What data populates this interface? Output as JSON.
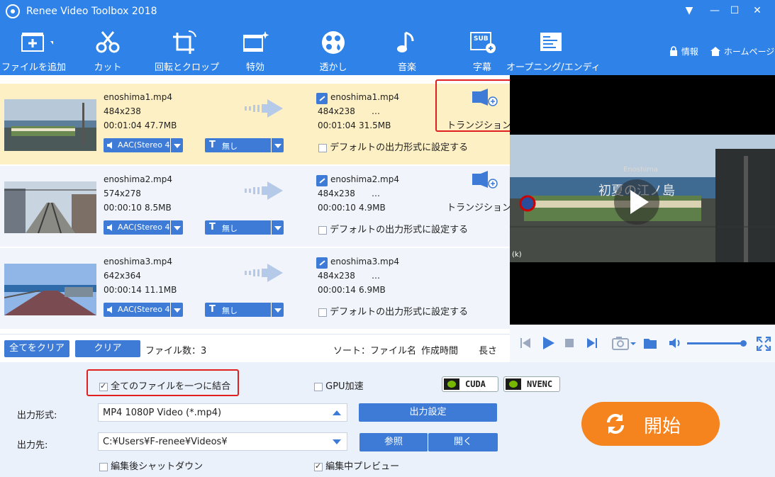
{
  "app": {
    "title": "Renee Video Toolbox 2018"
  },
  "window_controls": {
    "menu": "▼",
    "minimize": "—",
    "maximize": "☐",
    "close": "✕"
  },
  "toolbar": {
    "items": [
      {
        "label": "ファイルを追加",
        "icon": "add-file-icon"
      },
      {
        "label": "カット",
        "icon": "scissors-icon"
      },
      {
        "label": "回転とクロップ",
        "icon": "crop-rotate-icon"
      },
      {
        "label": "特効",
        "icon": "effects-icon"
      },
      {
        "label": "透かし",
        "icon": "watermark-icon"
      },
      {
        "label": "音楽",
        "icon": "music-note-icon"
      },
      {
        "label": "字幕",
        "icon": "subtitle-icon"
      },
      {
        "label": "オープニング/エンディ",
        "icon": "opening-ending-icon"
      }
    ],
    "info": "情報",
    "home": "ホームページ"
  },
  "files": [
    {
      "source": {
        "name": "enoshima1.mp4",
        "resolution": "484x238",
        "duration": "00:01:04",
        "size": "47.7MB"
      },
      "output": {
        "name": "enoshima1.mp4",
        "resolution": "484x238",
        "more": "…",
        "duration": "00:01:04",
        "size": "31.5MB"
      },
      "audio": "AAC(Stereo 4",
      "subtitle": "無し",
      "transition": "トランジション無",
      "default_format": "デフォルトの出力形式に設定する",
      "selected": true
    },
    {
      "source": {
        "name": "enoshima2.mp4",
        "resolution": "574x278",
        "duration": "00:00:10",
        "size": "8.5MB"
      },
      "output": {
        "name": "enoshima2.mp4",
        "resolution": "484x238",
        "more": "…",
        "duration": "00:00:10",
        "size": "4.9MB"
      },
      "audio": "AAC(Stereo 4",
      "subtitle": "無し",
      "transition": "トランジション無",
      "default_format": "デフォルトの出力形式に設定する",
      "selected": false
    },
    {
      "source": {
        "name": "enoshima3.mp4",
        "resolution": "642x364",
        "duration": "00:00:14",
        "size": "11.1MB"
      },
      "output": {
        "name": "enoshima3.mp4",
        "resolution": "484x238",
        "more": "…",
        "duration": "00:00:14",
        "size": "6.9MB"
      },
      "audio": "AAC(Stereo 4",
      "subtitle": "無し",
      "transition": "",
      "default_format": "デフォルトの出力形式に設定する",
      "selected": false
    }
  ],
  "list_footer": {
    "clear_all": "全てをクリア",
    "clear": "クリア",
    "file_count": "ファイル数：3",
    "sort_label": "ソート：ファイル名",
    "sort_created": "作成時間",
    "sort_length": "長さ"
  },
  "preview": {
    "overlay_text": "初夏の江ノ島",
    "overlay_small": "Enoshima",
    "corner_label": "(k)"
  },
  "player": {
    "volume_fraction": 0.98
  },
  "bottom": {
    "merge_label": "全てのファイルを一つに結合",
    "merge_checked": true,
    "gpu_label": "GPU加速",
    "gpu_checked": false,
    "cuda": "CUDA",
    "nvenc": "NVENC",
    "format_label": "出力形式:",
    "format_value": "MP4 1080P Video (*.mp4)",
    "output_settings": "出力設定",
    "dest_label": "出力先:",
    "dest_value": "C:¥Users¥F-renee¥Videos¥",
    "browse": "参照",
    "open": "開く",
    "shutdown_label": "編集後シャットダウン",
    "shutdown_checked": false,
    "preview_label": "編集中プレビュー",
    "preview_checked": true,
    "start": "開始"
  },
  "colors": {
    "primary": "#2f83e8",
    "button": "#3d7bd6",
    "selected_row": "#fdf0c5",
    "start": "#f5841f",
    "highlight": "#e02020"
  }
}
